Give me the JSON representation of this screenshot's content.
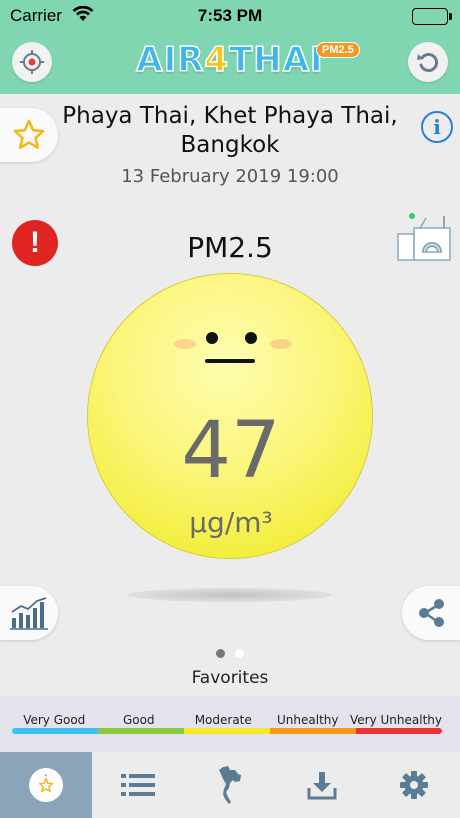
{
  "status_bar": {
    "carrier": "Carrier",
    "time": "7:53 PM",
    "battery_color": "#2dbd3a"
  },
  "header": {
    "logo": {
      "part1": "AIR",
      "part2": "4",
      "part3": "THAI",
      "badge": "PM2.5"
    },
    "locate_icon": "crosshair-icon",
    "refresh_icon": "refresh-icon"
  },
  "location": {
    "name": "Phaya Thai, Khet Phaya Thai, Bangkok",
    "datetime": "13 February 2019 19:00"
  },
  "info_label": "i",
  "alert_label": "!",
  "reading": {
    "pollutant": "PM2.5",
    "value": "47",
    "unit": "µg/m³",
    "level": "Moderate",
    "color": "#f3ee3d"
  },
  "pager": {
    "page": 1,
    "total": 2,
    "label": "Favorites"
  },
  "scale": {
    "levels": [
      {
        "label": "Very Good",
        "color": "#3cc2f0"
      },
      {
        "label": "Good",
        "color": "#8cc83f"
      },
      {
        "label": "Moderate",
        "color": "#f6e92b"
      },
      {
        "label": "Unhealthy",
        "color": "#f59a1d"
      },
      {
        "label": "Very Unhealthy",
        "color": "#ec3434"
      }
    ]
  },
  "tabs": [
    {
      "name": "favorites",
      "icon": "favorites-star-icon",
      "active": true
    },
    {
      "name": "list",
      "icon": "list-icon",
      "active": false
    },
    {
      "name": "map",
      "icon": "thailand-map-icon",
      "active": false
    },
    {
      "name": "download",
      "icon": "download-icon",
      "active": false
    },
    {
      "name": "settings",
      "icon": "gear-icon",
      "active": false
    }
  ]
}
